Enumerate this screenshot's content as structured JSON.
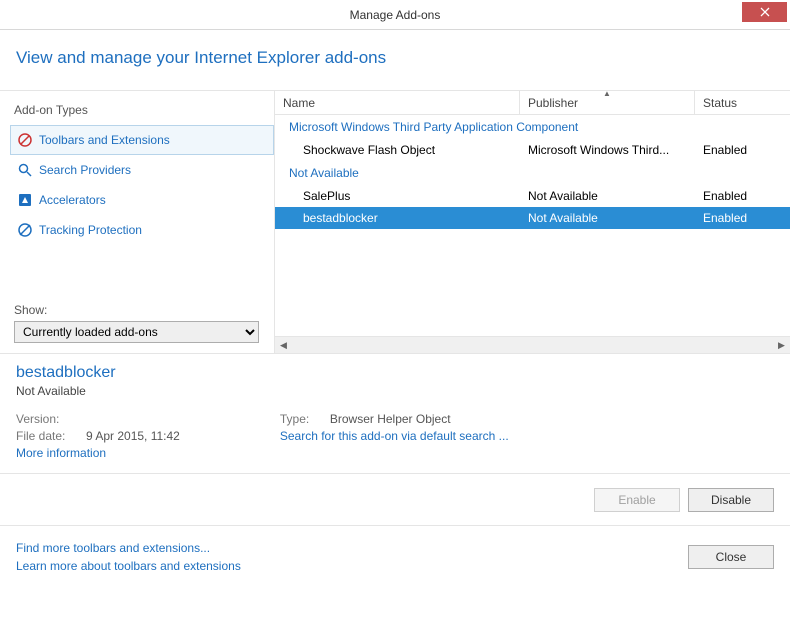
{
  "titlebar": {
    "title": "Manage Add-ons"
  },
  "header": {
    "heading": "View and manage your Internet Explorer add-ons"
  },
  "sidebar": {
    "title": "Add-on Types",
    "items": [
      {
        "label": "Toolbars and Extensions",
        "selected": true
      },
      {
        "label": "Search Providers",
        "selected": false
      },
      {
        "label": "Accelerators",
        "selected": false
      },
      {
        "label": "Tracking Protection",
        "selected": false
      }
    ],
    "show_label": "Show:",
    "show_value": "Currently loaded add-ons"
  },
  "list": {
    "columns": {
      "name": "Name",
      "publisher": "Publisher",
      "status": "Status"
    },
    "groups": [
      {
        "label": "Microsoft Windows Third Party Application Component",
        "items": [
          {
            "name": "Shockwave Flash Object",
            "publisher": "Microsoft Windows Third...",
            "status": "Enabled",
            "selected": false
          }
        ]
      },
      {
        "label": "Not Available",
        "items": [
          {
            "name": "SalePlus",
            "publisher": "Not Available",
            "status": "Enabled",
            "selected": false
          },
          {
            "name": "bestadblocker",
            "publisher": "Not Available",
            "status": "Enabled",
            "selected": true
          }
        ]
      }
    ]
  },
  "details": {
    "name": "bestadblocker",
    "publisher": "Not Available",
    "version_label": "Version:",
    "version": "",
    "filedate_label": "File date:",
    "filedate": "9 Apr 2015, 11:42",
    "more_info": "More information",
    "type_label": "Type:",
    "type": "Browser Helper Object",
    "search_link": "Search for this add-on via default search ..."
  },
  "actions": {
    "enable": "Enable",
    "disable": "Disable"
  },
  "footer": {
    "find_more": "Find more toolbars and extensions...",
    "learn_more": "Learn more about toolbars and extensions",
    "close": "Close"
  }
}
